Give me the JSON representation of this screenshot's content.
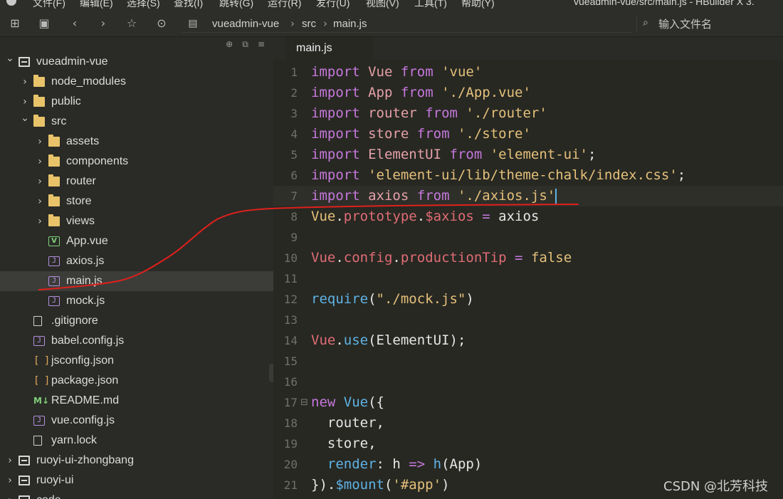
{
  "window": {
    "menu": [
      "文件(F)",
      "编辑(E)",
      "选择(S)",
      "查找(I)",
      "跳转(G)",
      "运行(R)",
      "发行(U)",
      "视图(V)",
      "工具(T)",
      "帮助(Y)"
    ],
    "title": "vueadmin-vue/src/main.js - HBuilder X 3."
  },
  "toolbar": {
    "icons": [
      "new-window-icon",
      "save-icon",
      "back-icon",
      "forward-icon",
      "star-icon",
      "run-icon"
    ],
    "breadcrumb": [
      "vueadmin-vue",
      "src",
      "main.js"
    ],
    "search_placeholder": "输入文件名"
  },
  "sidebar": {
    "tools": [
      "⊕",
      "⧉",
      "≡"
    ],
    "tree": [
      {
        "label": "vueadmin-vue",
        "depth": 0,
        "type": "root",
        "expanded": true
      },
      {
        "label": "node_modules",
        "depth": 1,
        "type": "folder",
        "expanded": false
      },
      {
        "label": "public",
        "depth": 1,
        "type": "folder",
        "expanded": false
      },
      {
        "label": "src",
        "depth": 1,
        "type": "folder",
        "expanded": true
      },
      {
        "label": "assets",
        "depth": 2,
        "type": "folder",
        "expanded": false
      },
      {
        "label": "components",
        "depth": 2,
        "type": "folder",
        "expanded": false
      },
      {
        "label": "router",
        "depth": 2,
        "type": "folder",
        "expanded": false
      },
      {
        "label": "store",
        "depth": 2,
        "type": "folder",
        "expanded": false
      },
      {
        "label": "views",
        "depth": 2,
        "type": "folder",
        "expanded": false
      },
      {
        "label": "App.vue",
        "depth": 2,
        "type": "vue"
      },
      {
        "label": "axios.js",
        "depth": 2,
        "type": "js"
      },
      {
        "label": "main.js",
        "depth": 2,
        "type": "js",
        "selected": true
      },
      {
        "label": "mock.js",
        "depth": 2,
        "type": "js"
      },
      {
        "label": ".gitignore",
        "depth": 1,
        "type": "file"
      },
      {
        "label": "babel.config.js",
        "depth": 1,
        "type": "js"
      },
      {
        "label": "jsconfig.json",
        "depth": 1,
        "type": "json"
      },
      {
        "label": "package.json",
        "depth": 1,
        "type": "json"
      },
      {
        "label": "README.md",
        "depth": 1,
        "type": "md"
      },
      {
        "label": "vue.config.js",
        "depth": 1,
        "type": "js"
      },
      {
        "label": "yarn.lock",
        "depth": 1,
        "type": "file"
      },
      {
        "label": "ruoyi-ui-zhongbang",
        "depth": 0,
        "type": "root",
        "expanded": false
      },
      {
        "label": "ruoyi-ui",
        "depth": 0,
        "type": "root",
        "expanded": false
      },
      {
        "label": "code",
        "depth": 0,
        "type": "root",
        "expanded": false
      }
    ]
  },
  "editor": {
    "tab_label": "main.js",
    "current_line": 7,
    "lines": [
      {
        "n": "1",
        "tokens": [
          [
            "kw",
            "import"
          ],
          [
            "punc",
            " "
          ],
          [
            "id",
            "Vue"
          ],
          [
            "punc",
            " "
          ],
          [
            "kw",
            "from"
          ],
          [
            "punc",
            " "
          ],
          [
            "str",
            "'vue'"
          ]
        ]
      },
      {
        "n": "2",
        "tokens": [
          [
            "kw",
            "import"
          ],
          [
            "punc",
            " "
          ],
          [
            "id",
            "App"
          ],
          [
            "punc",
            " "
          ],
          [
            "kw",
            "from"
          ],
          [
            "punc",
            " "
          ],
          [
            "str",
            "'./App.vue'"
          ]
        ]
      },
      {
        "n": "3",
        "tokens": [
          [
            "kw",
            "import"
          ],
          [
            "punc",
            " "
          ],
          [
            "id",
            "router"
          ],
          [
            "punc",
            " "
          ],
          [
            "kw",
            "from"
          ],
          [
            "punc",
            " "
          ],
          [
            "str",
            "'./router'"
          ]
        ]
      },
      {
        "n": "4",
        "tokens": [
          [
            "kw",
            "import"
          ],
          [
            "punc",
            " "
          ],
          [
            "id",
            "store"
          ],
          [
            "punc",
            " "
          ],
          [
            "kw",
            "from"
          ],
          [
            "punc",
            " "
          ],
          [
            "str",
            "'./store'"
          ]
        ]
      },
      {
        "n": "5",
        "tokens": [
          [
            "kw",
            "import"
          ],
          [
            "punc",
            " "
          ],
          [
            "id",
            "ElementUI"
          ],
          [
            "punc",
            " "
          ],
          [
            "kw",
            "from"
          ],
          [
            "punc",
            " "
          ],
          [
            "str",
            "'element-ui'"
          ],
          [
            "punc",
            ";"
          ]
        ]
      },
      {
        "n": "6",
        "tokens": [
          [
            "kw",
            "import"
          ],
          [
            "punc",
            " "
          ],
          [
            "str",
            "'element-ui/lib/theme-chalk/index.css'"
          ],
          [
            "punc",
            ";"
          ]
        ]
      },
      {
        "n": "7",
        "tokens": [
          [
            "kw",
            "import"
          ],
          [
            "punc",
            " "
          ],
          [
            "id",
            "axios"
          ],
          [
            "punc",
            " "
          ],
          [
            "kw",
            "from"
          ],
          [
            "punc",
            " "
          ],
          [
            "str",
            "'./axios.js'"
          ]
        ]
      },
      {
        "n": "8",
        "tokens": [
          [
            "str",
            "Vue"
          ],
          [
            "punc",
            "."
          ],
          [
            "prop",
            "prototype"
          ],
          [
            "punc",
            "."
          ],
          [
            "prop",
            "$axios"
          ],
          [
            "punc",
            " "
          ],
          [
            "kw",
            "="
          ],
          [
            "punc",
            " axios"
          ]
        ]
      },
      {
        "n": "9",
        "tokens": []
      },
      {
        "n": "10",
        "tokens": [
          [
            "prop",
            "Vue"
          ],
          [
            "punc",
            "."
          ],
          [
            "prop",
            "config"
          ],
          [
            "punc",
            "."
          ],
          [
            "prop",
            "productionTip"
          ],
          [
            "punc",
            " "
          ],
          [
            "kw",
            "="
          ],
          [
            "punc",
            " "
          ],
          [
            "val",
            "false"
          ]
        ]
      },
      {
        "n": "11",
        "tokens": []
      },
      {
        "n": "12",
        "tokens": [
          [
            "fn",
            "require"
          ],
          [
            "punc",
            "("
          ],
          [
            "str",
            "\"./mock.js\""
          ],
          [
            "punc",
            ")"
          ]
        ]
      },
      {
        "n": "13",
        "tokens": []
      },
      {
        "n": "14",
        "tokens": [
          [
            "prop",
            "Vue"
          ],
          [
            "punc",
            "."
          ],
          [
            "fn",
            "use"
          ],
          [
            "punc",
            "(ElementUI);"
          ]
        ]
      },
      {
        "n": "15",
        "tokens": []
      },
      {
        "n": "16",
        "tokens": []
      },
      {
        "n": "17",
        "fold": true,
        "tokens": [
          [
            "kw",
            "new"
          ],
          [
            "punc",
            " "
          ],
          [
            "fn",
            "Vue"
          ],
          [
            "punc",
            "({"
          ]
        ]
      },
      {
        "n": "18",
        "tokens": [
          [
            "punc",
            "  router,"
          ]
        ]
      },
      {
        "n": "19",
        "tokens": [
          [
            "punc",
            "  store,"
          ]
        ]
      },
      {
        "n": "20",
        "tokens": [
          [
            "punc",
            "  "
          ],
          [
            "fn",
            "render"
          ],
          [
            "punc",
            ": h "
          ],
          [
            "kw",
            "=>"
          ],
          [
            "punc",
            " "
          ],
          [
            "fn",
            "h"
          ],
          [
            "punc",
            "(App)"
          ]
        ]
      },
      {
        "n": "21",
        "tokens": [
          [
            "punc",
            "})."
          ],
          [
            "fn",
            "$mount"
          ],
          [
            "punc",
            "("
          ],
          [
            "str",
            "'#app'"
          ],
          [
            "punc",
            ")"
          ]
        ]
      }
    ]
  },
  "watermark": "CSDN @北芳科技",
  "colors": {
    "annotation": "#e0201c",
    "keyword": "#c678dd",
    "string": "#e5c07b"
  }
}
